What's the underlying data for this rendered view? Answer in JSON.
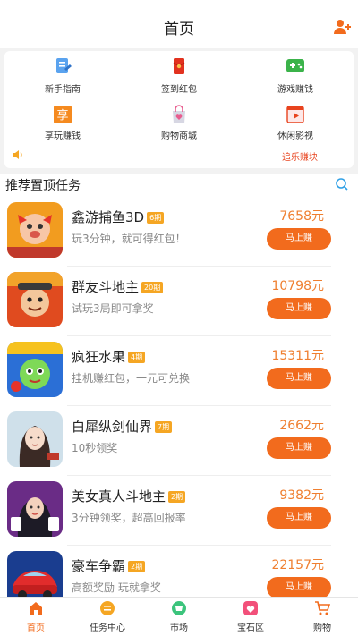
{
  "header": {
    "title": "首页",
    "user_icon": "user-plus-icon"
  },
  "menu": {
    "row1": [
      {
        "label": "新手指南",
        "icon": "guide-doc-icon",
        "color": "#3a8ee6"
      },
      {
        "label": "签到红包",
        "icon": "red-envelope-icon",
        "color": "#e2321f"
      },
      {
        "label": "游戏赚钱",
        "icon": "gamepad-icon",
        "color": "#3bb34a"
      }
    ],
    "row2": [
      {
        "label": "享玩赚钱",
        "icon": "enjoy-play-icon",
        "color": "#f58a1f"
      },
      {
        "label": "购物商城",
        "icon": "shopping-bag-icon",
        "color": "#e85d8f"
      },
      {
        "label": "休闲影视",
        "icon": "film-icon",
        "color": "#e8431e"
      }
    ],
    "notice": {
      "speaker_icon": "speaker-icon",
      "more_label": "追乐赚块"
    }
  },
  "section": {
    "title": "推荐置顶任务",
    "search_icon": "search-icon"
  },
  "tasks": [
    {
      "name": "鑫游捕鱼3D",
      "badge": "6期",
      "desc": "玩3分钟，就可得红包！",
      "reward": "7658元",
      "button": "马上赚"
    },
    {
      "name": "群友斗地主",
      "badge": "20期",
      "desc": "试玩3局即可拿奖",
      "reward": "10798元",
      "button": "马上赚"
    },
    {
      "name": "疯狂水果",
      "badge": "4期",
      "desc": "挂机赚红包，一元可兑换",
      "reward": "15311元",
      "button": "马上赚"
    },
    {
      "name": "白犀纵剑仙界",
      "badge": "7期",
      "desc": "10秒领奖",
      "reward": "2662元",
      "button": "马上赚"
    },
    {
      "name": "美女真人斗地主",
      "badge": "2期",
      "desc": "3分钟领奖，超高回报率",
      "reward": "9382元",
      "button": "马上赚"
    },
    {
      "name": "豪车争霸",
      "badge": "2期",
      "desc": "高额奖励 玩就拿奖",
      "reward": "22157元",
      "button": "马上赚"
    }
  ],
  "tabbar": [
    {
      "label": "首页",
      "icon": "home-icon",
      "active": true
    },
    {
      "label": "任务中心",
      "icon": "task-center-icon",
      "active": false
    },
    {
      "label": "市场",
      "icon": "market-icon",
      "active": false
    },
    {
      "label": "宝石区",
      "icon": "gem-zone-icon",
      "active": false
    },
    {
      "label": "购物",
      "icon": "cart-icon",
      "active": false
    }
  ],
  "colors": {
    "accent": "#f26b1d",
    "reward": "#ef7f30",
    "badge": "#f5a623"
  }
}
